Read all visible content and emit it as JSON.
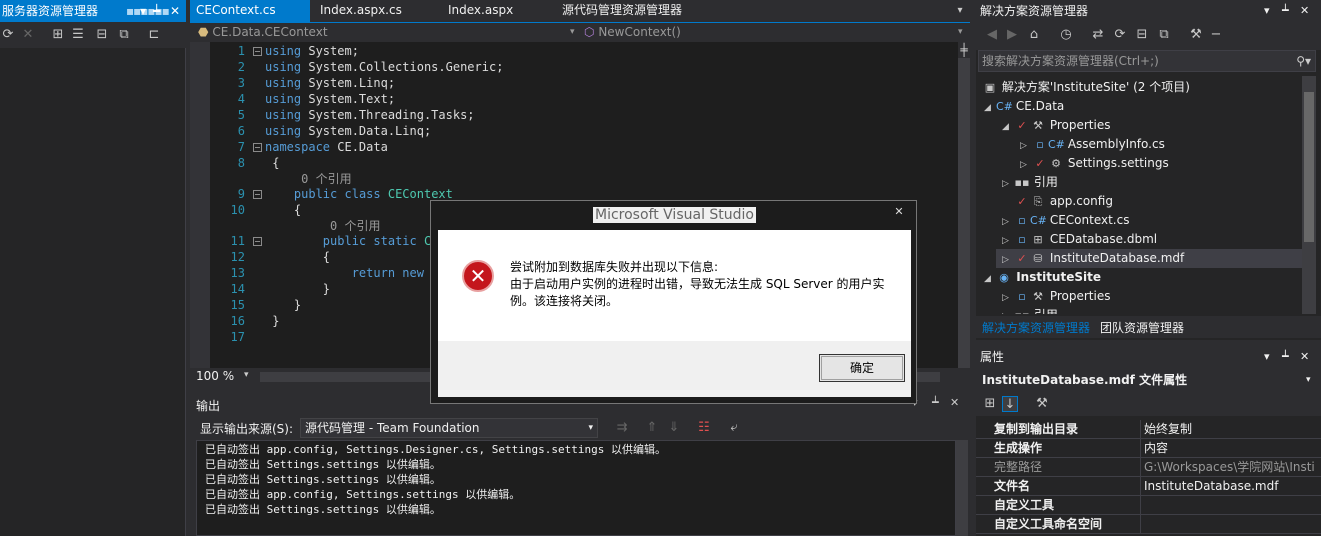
{
  "left_panel": {
    "title": "服务器资源管理器"
  },
  "doc_tabs": [
    {
      "label": "CEContext.cs",
      "active": true
    },
    {
      "label": "Index.aspx.cs",
      "active": false
    },
    {
      "label": "Index.aspx",
      "active": false
    },
    {
      "label": "源代码管理资源管理器",
      "active": false
    }
  ],
  "nav_bar": {
    "left_combo": "CE.Data.CEContext",
    "right_combo": "NewContext()"
  },
  "editor": {
    "zoom": "100 %"
  },
  "output": {
    "title": "输出",
    "source_label": "显示输出来源(S):",
    "source_value": "源代码管理 - Team Foundation",
    "lines": [
      "已自动签出 app.config, Settings.Designer.cs, Settings.settings 以供编辑。",
      "已自动签出 Settings.settings 以供编辑。",
      "已自动签出 Settings.settings 以供编辑。",
      "已自动签出 app.config, Settings.settings 以供编辑。",
      "已自动签出 Settings.settings 以供编辑。"
    ]
  },
  "solution_explorer": {
    "title": "解决方案资源管理器",
    "search_placeholder": "搜索解决方案资源管理器(Ctrl+;)",
    "tree": {
      "solution": "解决方案'InstituteSite' (2 个项目)",
      "ce_data": "CE.Data",
      "properties": "Properties",
      "assemblyinfo": "AssemblyInfo.cs",
      "settings": "Settings.settings",
      "references": "引用",
      "app_config": "app.config",
      "cecontext": "CEContext.cs",
      "cedatabase": "CEDatabase.dbml",
      "institutedb": "InstituteDatabase.mdf",
      "institutesite": "InstituteSite",
      "properties2": "Properties",
      "references2": "引用"
    },
    "tabs": [
      "解决方案资源管理器",
      "团队资源管理器"
    ]
  },
  "properties": {
    "title": "属性",
    "object": "InstituteDatabase.mdf  文件属性",
    "rows": [
      {
        "name": "复制到输出目录",
        "value": "始终复制"
      },
      {
        "name": "生成操作",
        "value": "内容"
      },
      {
        "name": "完整路径",
        "value": "G:\\Workspaces\\学院网站\\Insti"
      },
      {
        "name": "文件名",
        "value": "InstituteDatabase.mdf"
      },
      {
        "name": "自定义工具",
        "value": ""
      },
      {
        "name": "自定义工具命名空间",
        "value": ""
      }
    ]
  },
  "dialog": {
    "title": "Microsoft Visual Studio",
    "message_line1": "尝试附加到数据库失败并出现以下信息:",
    "message_line2": "由于启动用户实例的进程时出错，导致无法生成 SQL Server 的用户实例。该连接将关闭。",
    "ok_label": "确定"
  },
  "colors": {
    "accent": "#007acc",
    "keyword": "#569cd6",
    "type": "#4ec9b0",
    "line_number": "#2b91af",
    "error_icon": "#c4161c"
  }
}
